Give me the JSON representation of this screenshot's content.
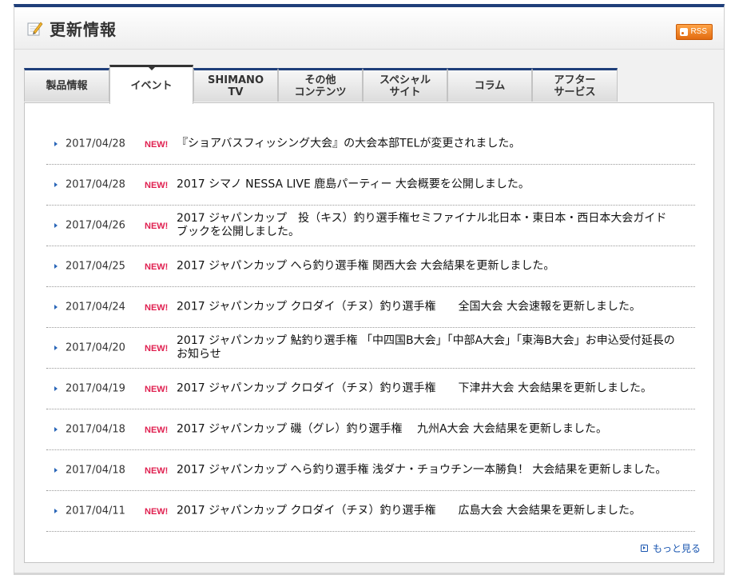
{
  "header": {
    "title": "更新情報",
    "rss_label": "RSS"
  },
  "tabs": [
    {
      "label": "製品情報",
      "active": false
    },
    {
      "label": "イベント",
      "active": true
    },
    {
      "label": "SHIMANO\nTV",
      "active": false
    },
    {
      "label": "その他\nコンテンツ",
      "active": false
    },
    {
      "label": "スペシャル\nサイト",
      "active": false
    },
    {
      "label": "コラム",
      "active": false
    },
    {
      "label": "アフター\nサービス",
      "active": false
    }
  ],
  "news": [
    {
      "date": "2017/04/28",
      "badge": "NEW!",
      "text": "『ショアバスフィッシング大会』の大会本部TELが変更されました。"
    },
    {
      "date": "2017/04/28",
      "badge": "NEW!",
      "text": "2017 シマノ NESSA LIVE 鹿島パーティー 大会概要を公開しました。"
    },
    {
      "date": "2017/04/26",
      "badge": "NEW!",
      "text": "2017 ジャパンカップ　投（キス）釣り選手権セミファイナル北日本・東日本・西日本大会ガイドブックを公開しました。"
    },
    {
      "date": "2017/04/25",
      "badge": "NEW!",
      "text": "2017 ジャパンカップ へら釣り選手権 関西大会 大会結果を更新しました。"
    },
    {
      "date": "2017/04/24",
      "badge": "NEW!",
      "text": "2017 ジャパンカップ クロダイ（チヌ）釣り選手権　　全国大会 大会速報を更新しました。"
    },
    {
      "date": "2017/04/20",
      "badge": "NEW!",
      "text": "2017 ジャパンカップ 鮎釣り選手権 「中四国B大会」「中部A大会」「東海B大会」お申込受付延長のお知らせ"
    },
    {
      "date": "2017/04/19",
      "badge": "NEW!",
      "text": "2017 ジャパンカップ クロダイ（チヌ）釣り選手権　　下津井大会 大会結果を更新しました。"
    },
    {
      "date": "2017/04/18",
      "badge": "NEW!",
      "text": "2017 ジャパンカップ 磯（グレ）釣り選手権　 九州A大会 大会結果を更新しました。"
    },
    {
      "date": "2017/04/18",
      "badge": "NEW!",
      "text": "2017 ジャパンカップ へら釣り選手権 浅ダナ・チョウチン一本勝負！ 大会結果を更新しました。"
    },
    {
      "date": "2017/04/11",
      "badge": "NEW!",
      "text": "2017 ジャパンカップ クロダイ（チヌ）釣り選手権　　広島大会 大会結果を更新しました。"
    }
  ],
  "more_label": "もっと見る",
  "colors": {
    "accent": "#1f3f7a",
    "badge": "#e02050",
    "link": "#1a56b0",
    "rss": "#e26b10"
  }
}
